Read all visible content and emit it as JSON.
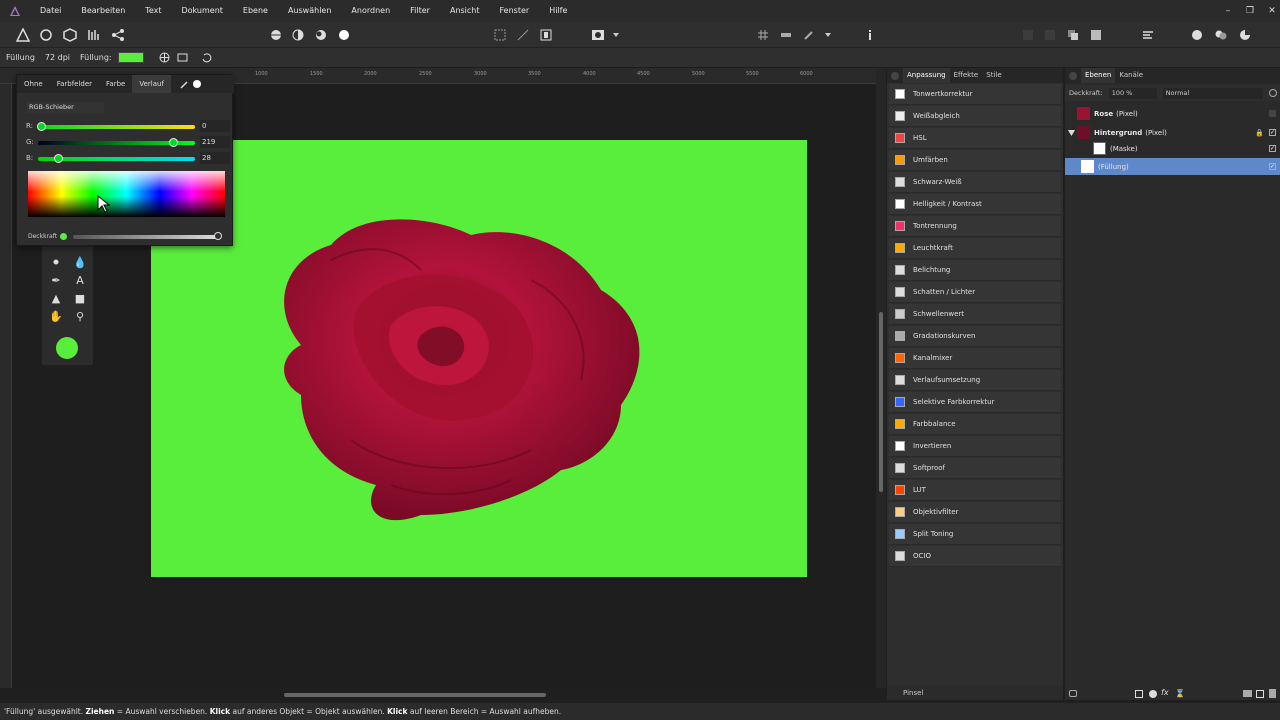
{
  "menu": [
    "Datei",
    "Bearbeiten",
    "Text",
    "Dokument",
    "Ebene",
    "Auswählen",
    "Anordnen",
    "Filter",
    "Ansicht",
    "Fenster",
    "Hilfe"
  ],
  "contextbar": {
    "fill_label": "Füllung",
    "dpi": "72 dpi",
    "fill_label2": "Füllung:",
    "fill_color": "#5aee3c"
  },
  "ruler": [
    "1000",
    "1500",
    "2000",
    "2500",
    "3000",
    "3500",
    "4000",
    "4500",
    "5000",
    "5500",
    "6000"
  ],
  "color_panel": {
    "tabs": [
      "Ohne",
      "Farbfelder",
      "Farbe",
      "Verlauf"
    ],
    "active_tab": "Verlauf",
    "mode": "RGB-Schieber",
    "r_label": "R:",
    "r_value": "0",
    "r_fraction": 0.0,
    "g_label": "G:",
    "g_value": "219",
    "g_fraction": 0.86,
    "b_label": "B:",
    "b_value": "28",
    "b_fraction": 0.11,
    "opacity_label": "Deckkraft",
    "opacity_fraction": 1.0
  },
  "canvas": {
    "background_color": "#5aee3c"
  },
  "adjustments": {
    "tabs": [
      "Anpassung",
      "Effekte",
      "Stile"
    ],
    "items": [
      "Tonwertkorrektur",
      "Weißabgleich",
      "HSL",
      "Umfärben",
      "Schwarz-Weiß",
      "Helligkeit / Kontrast",
      "Tontrennung",
      "Leuchtkraft",
      "Belichtung",
      "Schatten / Lichter",
      "Schwellenwert",
      "Gradationskurven",
      "Kanalmixer",
      "Verlaufsumsetzung",
      "Selektive Farbkorrektur",
      "Farbbalance",
      "Invertieren",
      "Softproof",
      "LUT",
      "Objektivfilter",
      "Split Toning",
      "OCIO"
    ],
    "brush_label": "Pinsel"
  },
  "layers": {
    "tabs": [
      "Ebenen",
      "Kanäle"
    ],
    "opacity_label": "Deckkraft:",
    "opacity_value": "100 %",
    "blend_mode": "Normal",
    "rows": [
      {
        "name": "Rose",
        "type": "(Pixel)"
      },
      {
        "name": "Hintergrund",
        "type": "(Pixel)"
      },
      {
        "name": "",
        "type": "(Maske)"
      },
      {
        "name": "",
        "type": "(Füllung)"
      }
    ]
  },
  "status": {
    "part1": "'Füllung' ausgewählt. ",
    "b1": "Ziehen",
    "part2": " = Auswahl verschieben. ",
    "b2": "Klick",
    "part3": " auf anderes Objekt = Objekt auswählen. ",
    "b3": "Klick",
    "part4": " auf leeren Bereich = Auswahl aufheben."
  }
}
